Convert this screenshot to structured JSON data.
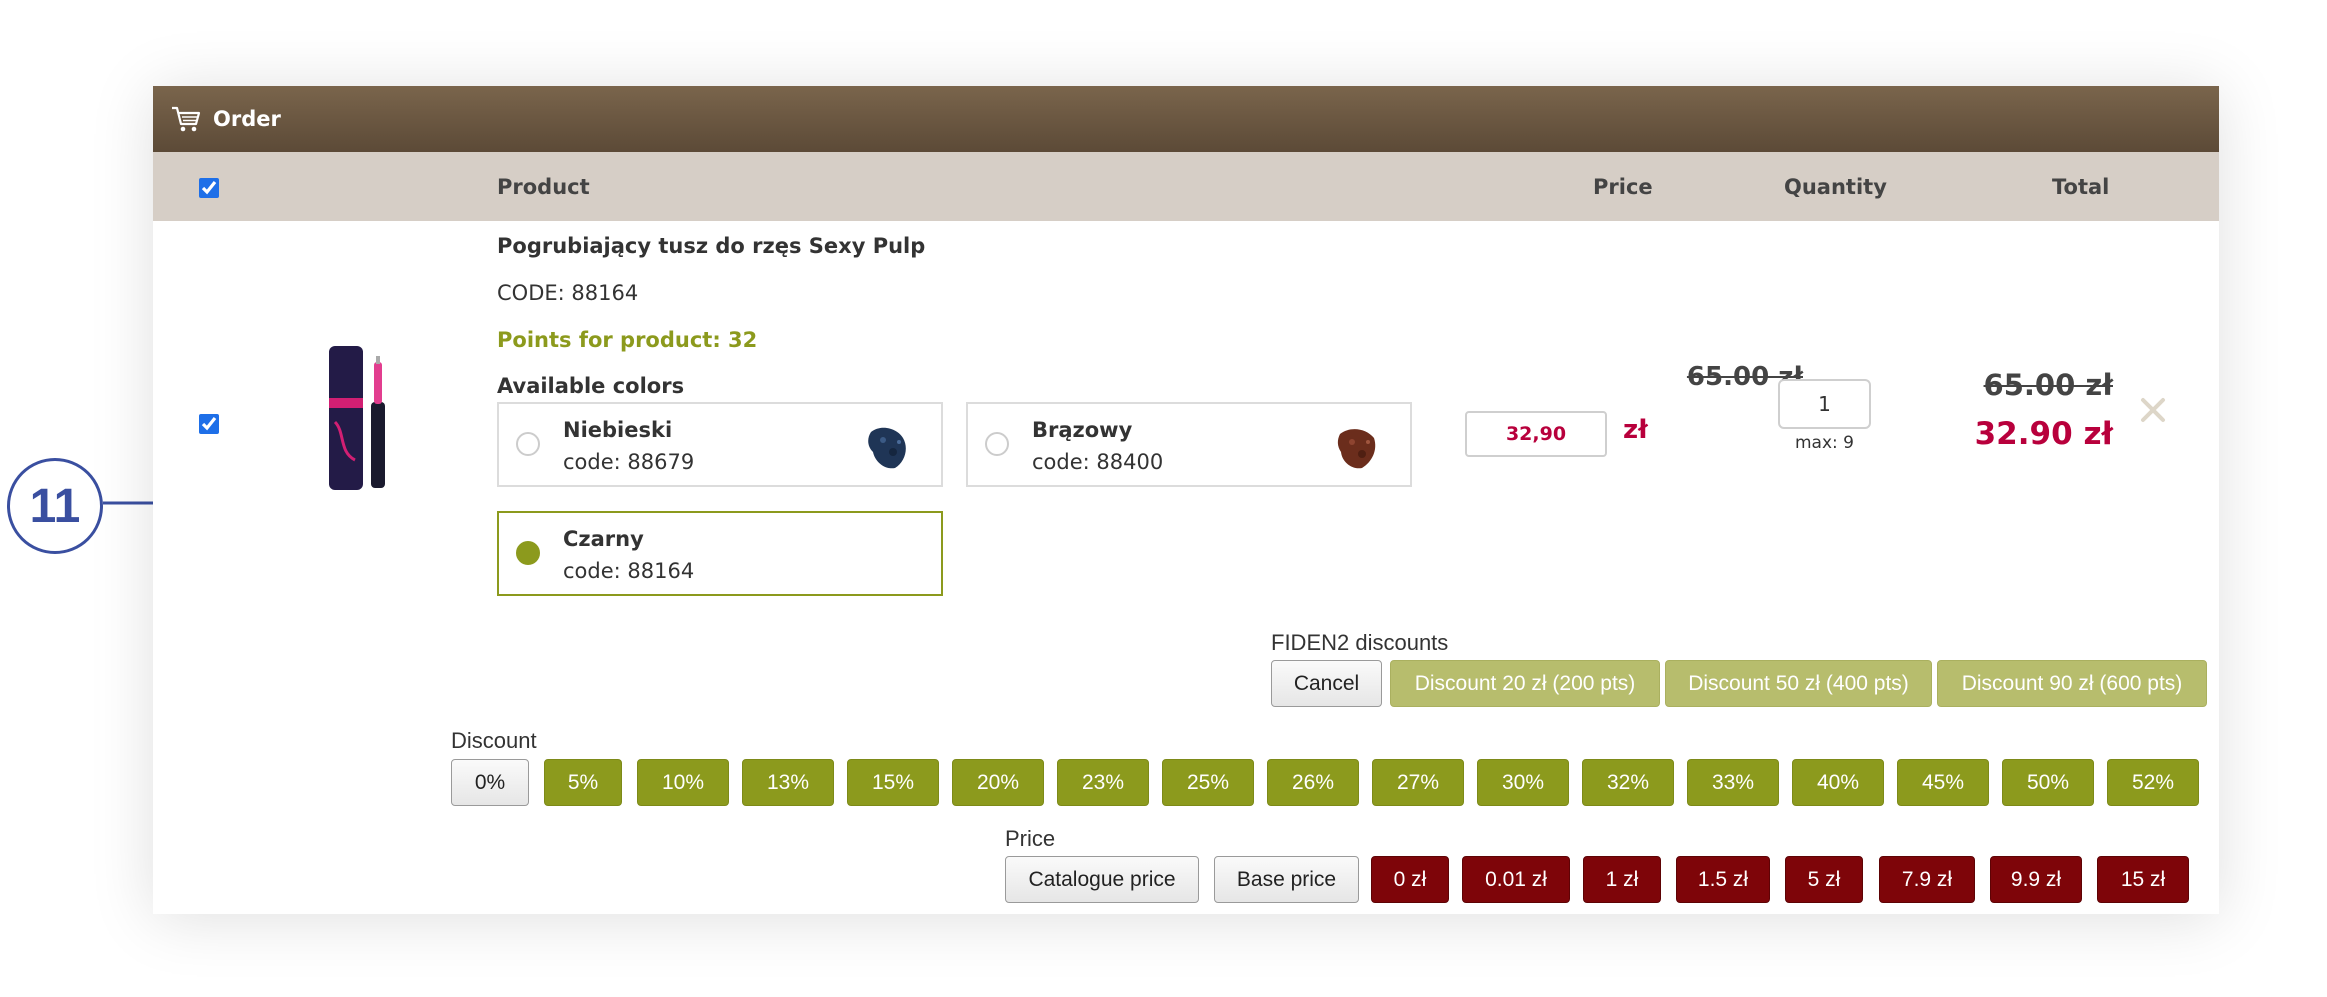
{
  "header": {
    "title": "Order",
    "icon": "shopping-cart-icon"
  },
  "table": {
    "columns": {
      "product": "Product",
      "price": "Price",
      "quantity": "Quantity",
      "total": "Total"
    }
  },
  "product": {
    "name": "Pogrubiający tusz do rzęs Sexy Pulp",
    "code": "CODE: 88164",
    "points": "Points for product: 32",
    "colors_label": "Available colors",
    "colors": [
      {
        "name": "Niebieski",
        "code": "code: 88679",
        "swatch": "#1f3556",
        "selected": false
      },
      {
        "name": "Brązowy",
        "code": "code: 88400",
        "swatch": "#6b2d1c",
        "selected": false
      },
      {
        "name": "Czarny",
        "code": "code: 88164",
        "swatch": "",
        "selected": true
      }
    ]
  },
  "price": {
    "old": "65.00 zł",
    "input_value": "32,90",
    "currency": "zł"
  },
  "quantity": {
    "value": "1",
    "max": "max: 9"
  },
  "total": {
    "old": "65.00 zł",
    "new": "32.90 zł"
  },
  "remove_icon": "close-icon",
  "fiden": {
    "label": "FIDEN2 discounts",
    "cancel": "Cancel",
    "buttons": [
      "Discount 20 zł (200 pts)",
      "Discount 50 zł (400 pts)",
      "Discount 90 zł (600 pts)"
    ]
  },
  "discount": {
    "label": "Discount",
    "buttons": [
      "0%",
      "5%",
      "10%",
      "13%",
      "15%",
      "20%",
      "23%",
      "25%",
      "26%",
      "27%",
      "30%",
      "32%",
      "33%",
      "40%",
      "45%",
      "50%",
      "52%"
    ]
  },
  "price_presets": {
    "label": "Price",
    "catalogue": "Catalogue price",
    "base": "Base price",
    "buttons": [
      "0 zł",
      "0.01 zł",
      "1 zł",
      "1.5 zł",
      "5 zł",
      "7.9 zł",
      "9.9 zł",
      "15 zł"
    ]
  },
  "callout": {
    "number": "11"
  },
  "colors": {
    "accent_olive": "#8c9a1d",
    "price_red": "#b8003c",
    "header_brown": "#6b5640",
    "preset_red": "#7e0509"
  }
}
